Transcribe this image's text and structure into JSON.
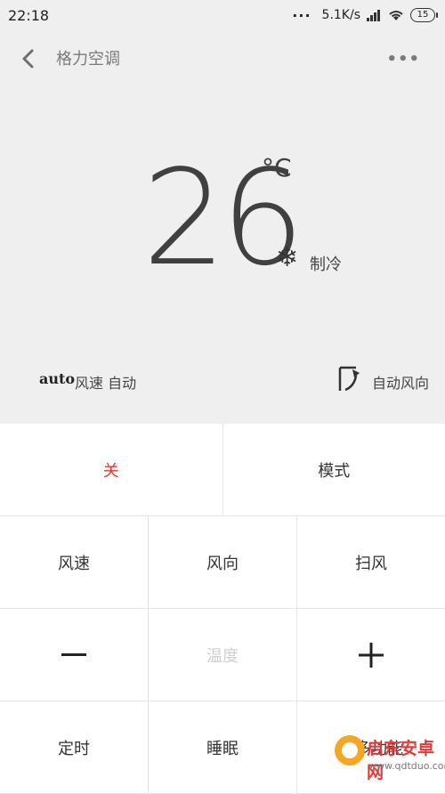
{
  "status_bar": {
    "time": "22:18",
    "network_speed": "5.1K/s",
    "battery": "15"
  },
  "header": {
    "title": "格力空调"
  },
  "display": {
    "temperature": "26",
    "unit": "°C",
    "mode": "制冷",
    "fan_badge": "auto",
    "fan_label": "风速 自动",
    "swing_label": "自动风向"
  },
  "controls": {
    "power": "关",
    "mode": "模式",
    "fan_speed": "风速",
    "direction": "风向",
    "sweep": "扫风",
    "temp_label": "温度",
    "timer": "定时",
    "sleep": "睡眠",
    "more": "更多功能"
  },
  "watermark": {
    "name": "启东安卓网",
    "url": "www.qdtduo.com"
  },
  "colors": {
    "power_off": "#e53935",
    "background_top": "#efefef"
  }
}
